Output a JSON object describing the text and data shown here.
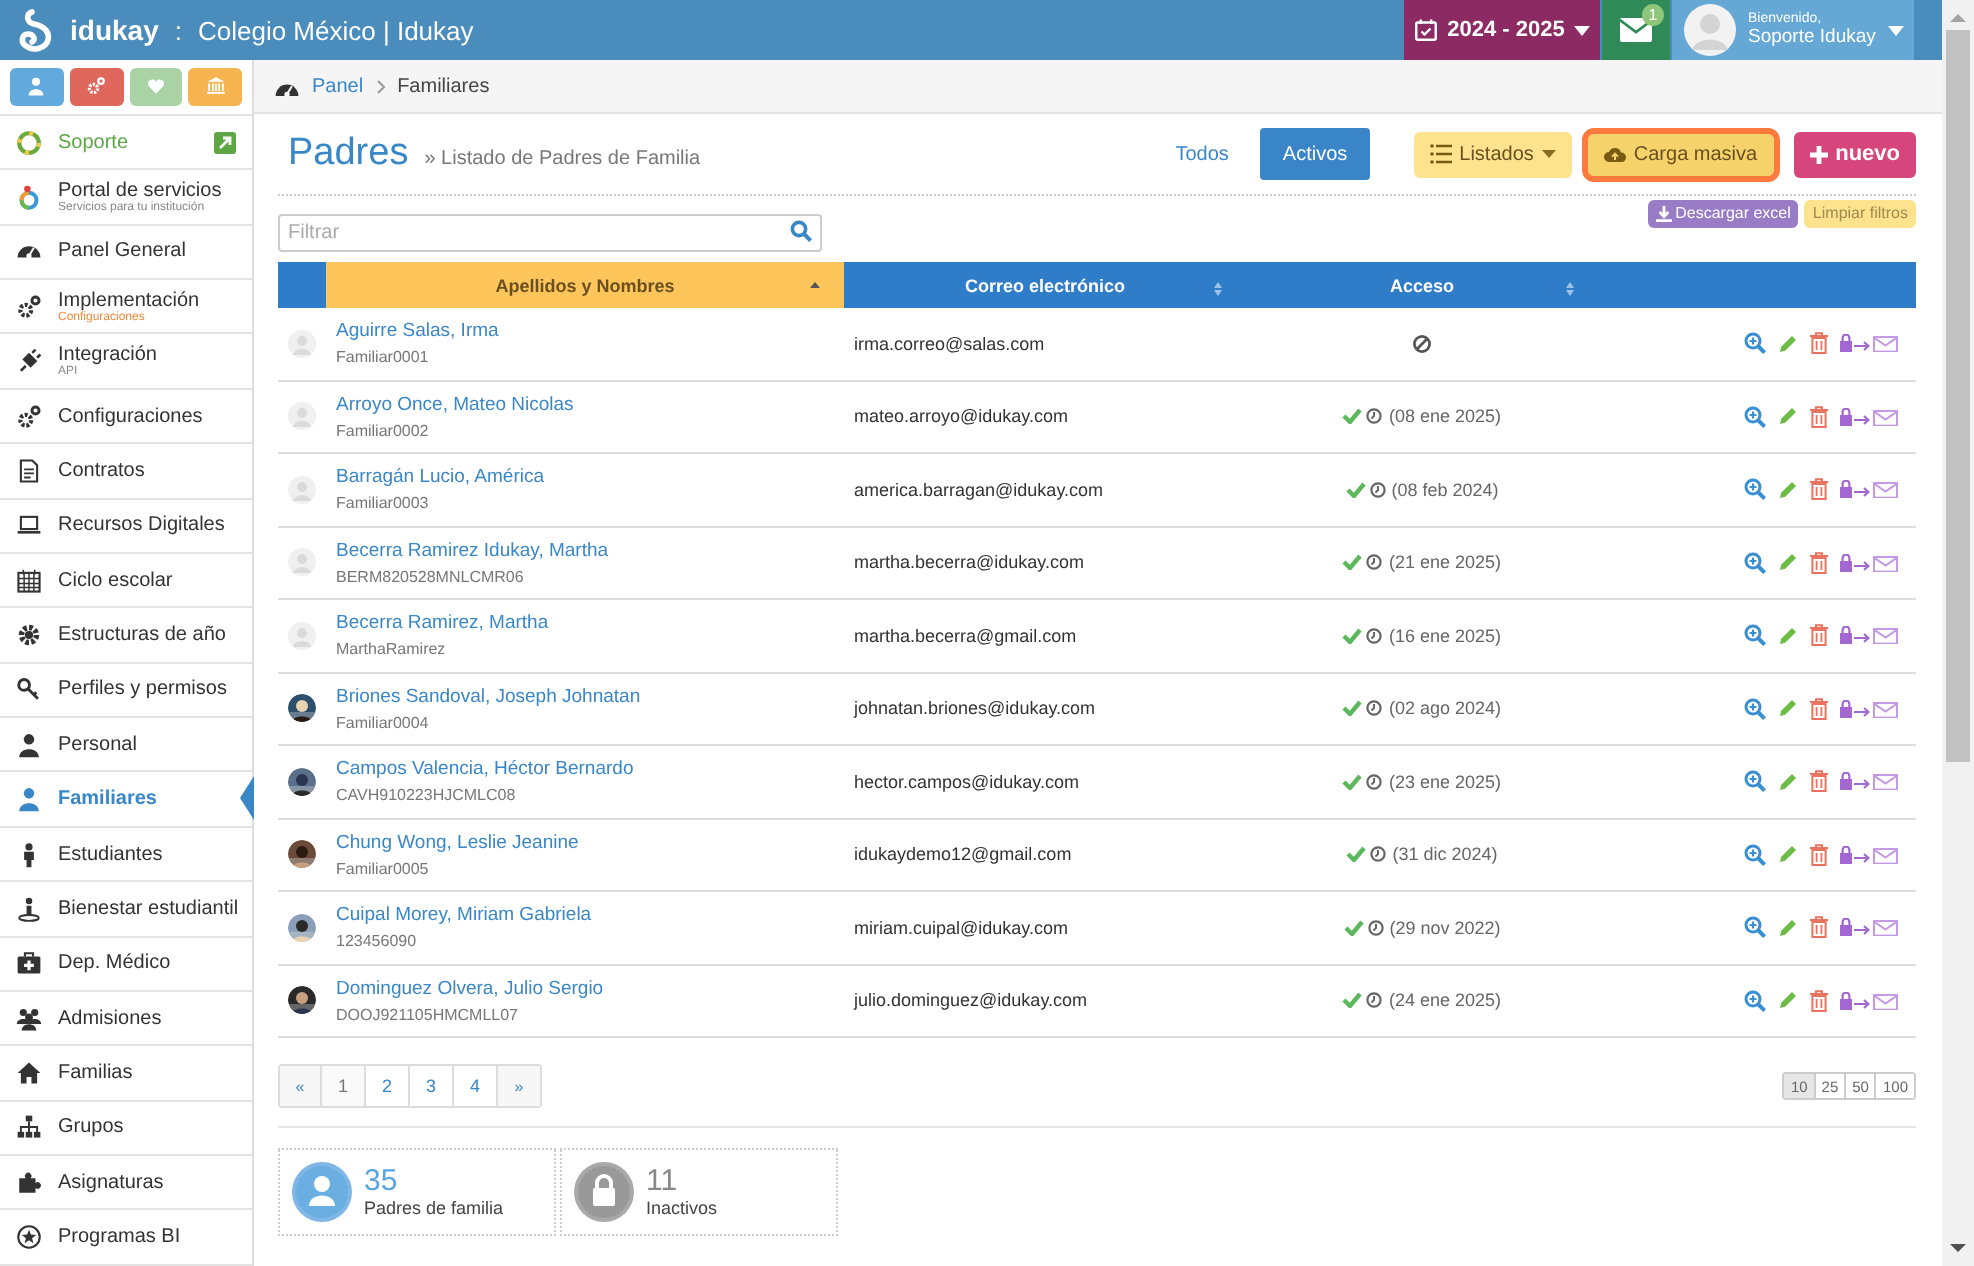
{
  "topbar": {
    "brand": "idukay",
    "separator": ":",
    "school": "Colegio México | Idukay",
    "year": "2024 - 2025",
    "mail_count": "1",
    "greeting": "Bienvenido,",
    "user": "Soporte Idukay"
  },
  "sidebar": {
    "quick_buttons": [
      {
        "color": "#62a9dd"
      },
      {
        "color": "#e0675b"
      },
      {
        "color": "#a9d3a4"
      },
      {
        "color": "#f6b451"
      }
    ],
    "items": [
      {
        "label": "Soporte",
        "kind": "support",
        "selected": false
      },
      {
        "label": "Portal de servicios",
        "subtitle": "Servicios para tu institución",
        "subtitle_accent": false,
        "kind": "link",
        "selected": false
      },
      {
        "label": "Panel General",
        "kind": "link",
        "selected": false
      },
      {
        "label": "Implementación",
        "subtitle": "Configuraciones",
        "subtitle_accent": true,
        "kind": "link",
        "selected": false
      },
      {
        "label": "Integración",
        "subtitle": "API",
        "subtitle_accent": false,
        "kind": "link",
        "selected": false
      },
      {
        "label": "Configuraciones",
        "kind": "link",
        "selected": false
      },
      {
        "label": "Contratos",
        "kind": "link",
        "selected": false
      },
      {
        "label": "Recursos Digitales",
        "kind": "link",
        "selected": false
      },
      {
        "label": "Ciclo escolar",
        "kind": "link",
        "selected": false
      },
      {
        "label": "Estructuras de año",
        "kind": "link",
        "selected": false
      },
      {
        "label": "Perfiles y permisos",
        "kind": "link",
        "selected": false
      },
      {
        "label": "Personal",
        "kind": "link",
        "selected": false
      },
      {
        "label": "Familiares",
        "kind": "link",
        "selected": true
      },
      {
        "label": "Estudiantes",
        "kind": "link",
        "selected": false
      },
      {
        "label": "Bienestar estudiantil",
        "kind": "link",
        "selected": false
      },
      {
        "label": "Dep. Médico",
        "kind": "link",
        "selected": false
      },
      {
        "label": "Admisiones",
        "kind": "link",
        "selected": false
      },
      {
        "label": "Familias",
        "kind": "link",
        "selected": false
      },
      {
        "label": "Grupos",
        "kind": "link",
        "selected": false
      },
      {
        "label": "Asignaturas",
        "kind": "link",
        "selected": false
      },
      {
        "label": "Programas BI",
        "kind": "link",
        "selected": false
      }
    ]
  },
  "breadcrumb": [
    "Panel",
    "Familiares"
  ],
  "page": {
    "title": "Padres",
    "subtitle": "» Listado de Padres de Familia"
  },
  "filters": [
    {
      "label": "Todos",
      "selected": false
    },
    {
      "label": "Activos",
      "selected": true
    }
  ],
  "actions": [
    {
      "label": "Listados",
      "kind": "dropdown",
      "focused": false
    },
    {
      "label": "Carga masiva",
      "kind": "upload",
      "focused": true
    },
    {
      "label": "nuevo",
      "kind": "create",
      "focused": false
    }
  ],
  "search": {
    "placeholder": "Filtrar"
  },
  "tools": [
    {
      "label": "Descargar excel",
      "kind": "download"
    },
    {
      "label": "Limpiar filtros",
      "kind": "clear"
    }
  ],
  "table": {
    "columns": [
      {
        "label": "Apellidos y Nombres",
        "sorted": true
      },
      {
        "label": "Correo electrónico",
        "sorted": false
      },
      {
        "label": "Acceso",
        "sorted": false
      }
    ],
    "rows": [
      {
        "name": "Aguirre Salas, Irma",
        "username": "Familiar0001",
        "email": "irma.correo@salas.com",
        "has_access": false,
        "photo": false
      },
      {
        "name": "Arroyo Once, Mateo Nicolas",
        "username": "Familiar0002",
        "email": "mateo.arroyo@idukay.com",
        "has_access": true,
        "last_access": "(08 ene 2025)",
        "photo": false
      },
      {
        "name": "Barragán Lucio, América",
        "username": "Familiar0003",
        "email": "america.barragan@idukay.com",
        "has_access": true,
        "last_access": "(08 feb 2024)",
        "photo": false
      },
      {
        "name": "Becerra Ramirez Idukay, Martha",
        "username": "BERM820528MNLCMR06",
        "email": "martha.becerra@idukay.com",
        "has_access": true,
        "last_access": "(21 ene 2025)",
        "photo": false
      },
      {
        "name": "Becerra Ramirez, Martha",
        "username": "MarthaRamirez",
        "email": "martha.becerra@gmail.com",
        "has_access": true,
        "last_access": "(16 ene 2025)",
        "photo": false
      },
      {
        "name": "Briones Sandoval, Joseph Johnatan",
        "username": "Familiar0004",
        "email": "johnatan.briones@idukay.com",
        "has_access": true,
        "last_access": "(02 ago 2024)",
        "photo": true
      },
      {
        "name": "Campos Valencia, Héctor Bernardo",
        "username": "CAVH910223HJCMLC08",
        "email": "hector.campos@idukay.com",
        "has_access": true,
        "last_access": "(23 ene 2025)",
        "photo": true
      },
      {
        "name": "Chung Wong, Leslie Jeanine",
        "username": "Familiar0005",
        "email": "idukaydemo12@gmail.com",
        "has_access": true,
        "last_access": "(31 dic 2024)",
        "photo": true
      },
      {
        "name": "Cuipal Morey, Miriam Gabriela",
        "username": "123456090",
        "email": "miriam.cuipal@idukay.com",
        "has_access": true,
        "last_access": "(29 nov 2022)",
        "photo": true
      },
      {
        "name": "Dominguez Olvera, Julio Sergio",
        "username": "DOOJ921105HMCMLL07",
        "email": "julio.dominguez@idukay.com",
        "has_access": true,
        "last_access": "(24 ene 2025)",
        "photo": true
      }
    ]
  },
  "pagination": [
    {
      "label": "«",
      "selected": false
    },
    {
      "label": "1",
      "selected": true
    },
    {
      "label": "2",
      "selected": false
    },
    {
      "label": "3",
      "selected": false
    },
    {
      "label": "4",
      "selected": false
    },
    {
      "label": "»",
      "selected": false
    }
  ],
  "page_sizes": [
    {
      "label": "10",
      "selected": true
    },
    {
      "label": "25",
      "selected": false
    },
    {
      "label": "50",
      "selected": false
    },
    {
      "label": "100",
      "selected": false
    }
  ],
  "stats": [
    {
      "value": "35",
      "label": "Padres de familia",
      "kind": "parents"
    },
    {
      "value": "11",
      "label": "Inactivos",
      "kind": "inactive"
    }
  ]
}
